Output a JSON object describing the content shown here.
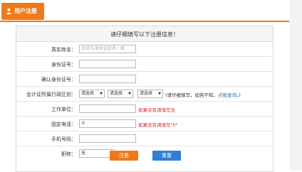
{
  "header": {
    "title": "用户注册",
    "accent": "#ef7a1c"
  },
  "panel": {
    "heading": "请仔细填写以下注册信息！"
  },
  "form": {
    "real_name": {
      "label": "真实姓名：",
      "placeholder": "姓名与身份证姓名一致"
    },
    "id_number": {
      "label": "身份证号："
    },
    "confirm_id": {
      "label": "确认身份证号："
    },
    "district": {
      "label": "会计证所属行政区划：",
      "select1": "请选择",
      "select2": "请选择",
      "select3": "请选择",
      "hint_prefix": "(请仔细填写，如若不知，",
      "hint_link": "点我查询",
      "hint_suffix": "。)"
    },
    "work_unit": {
      "label": "工作单位：",
      "note": "如果没有请填写无"
    },
    "phone": {
      "label": "固定电话：",
      "value": "0",
      "note": "如果没有请填写\"0\""
    },
    "mobile": {
      "label": "手机号码："
    },
    "title": {
      "label": "职称：",
      "selected": "无"
    }
  },
  "buttons": {
    "register": "注册",
    "reset": "重置"
  },
  "colors": {
    "register_btn": "#ef7a1c",
    "reset_btn": "#2f7fd4",
    "note_red": "#d42a2a",
    "link_blue": "#2a6fc8"
  }
}
